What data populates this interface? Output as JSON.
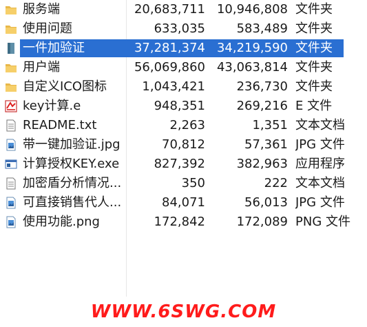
{
  "files": [
    {
      "name": "服务端",
      "size": "20,683,711",
      "packed": "10,946,808",
      "type": "文件夹",
      "icon": "folder-icon",
      "selected": false
    },
    {
      "name": "使用问题",
      "size": "633,035",
      "packed": "583,489",
      "type": "文件夹",
      "icon": "folder-icon",
      "selected": false
    },
    {
      "name": "一件加验证",
      "size": "37,281,374",
      "packed": "34,219,590",
      "type": "文件夹",
      "icon": "folder-icon",
      "selected": true
    },
    {
      "name": "用户端",
      "size": "56,069,860",
      "packed": "43,063,814",
      "type": "文件夹",
      "icon": "folder-icon",
      "selected": false
    },
    {
      "name": "自定义ICO图标",
      "size": "1,043,421",
      "packed": "236,730",
      "type": "文件夹",
      "icon": "folder-icon",
      "selected": false
    },
    {
      "name": "key计算.e",
      "size": "948,351",
      "packed": "269,216",
      "type": "E 文件",
      "icon": "e-file-icon",
      "selected": false
    },
    {
      "name": "README.txt",
      "size": "2,263",
      "packed": "1,351",
      "type": "文本文档",
      "icon": "text-file-icon",
      "selected": false
    },
    {
      "name": "带一键加验证.jpg",
      "size": "70,812",
      "packed": "57,361",
      "type": "JPG 文件",
      "icon": "image-file-icon",
      "selected": false
    },
    {
      "name": "计算授权KEY.exe",
      "size": "827,392",
      "packed": "382,963",
      "type": "应用程序",
      "icon": "exe-file-icon",
      "selected": false
    },
    {
      "name": "加密盾分析情况...",
      "size": "350",
      "packed": "222",
      "type": "文本文档",
      "icon": "text-file-icon",
      "selected": false
    },
    {
      "name": "可直接销售代人...",
      "size": "84,071",
      "packed": "56,013",
      "type": "JPG 文件",
      "icon": "image-file-icon",
      "selected": false
    },
    {
      "name": "使用功能.png",
      "size": "172,842",
      "packed": "172,089",
      "type": "PNG 文件",
      "icon": "image-file-icon",
      "selected": false
    }
  ],
  "watermark": "WWW.6SWG.COM",
  "colors": {
    "selection": "#2a6fd2",
    "folder": "#e8b84a",
    "watermark": "#ff1b1b"
  }
}
